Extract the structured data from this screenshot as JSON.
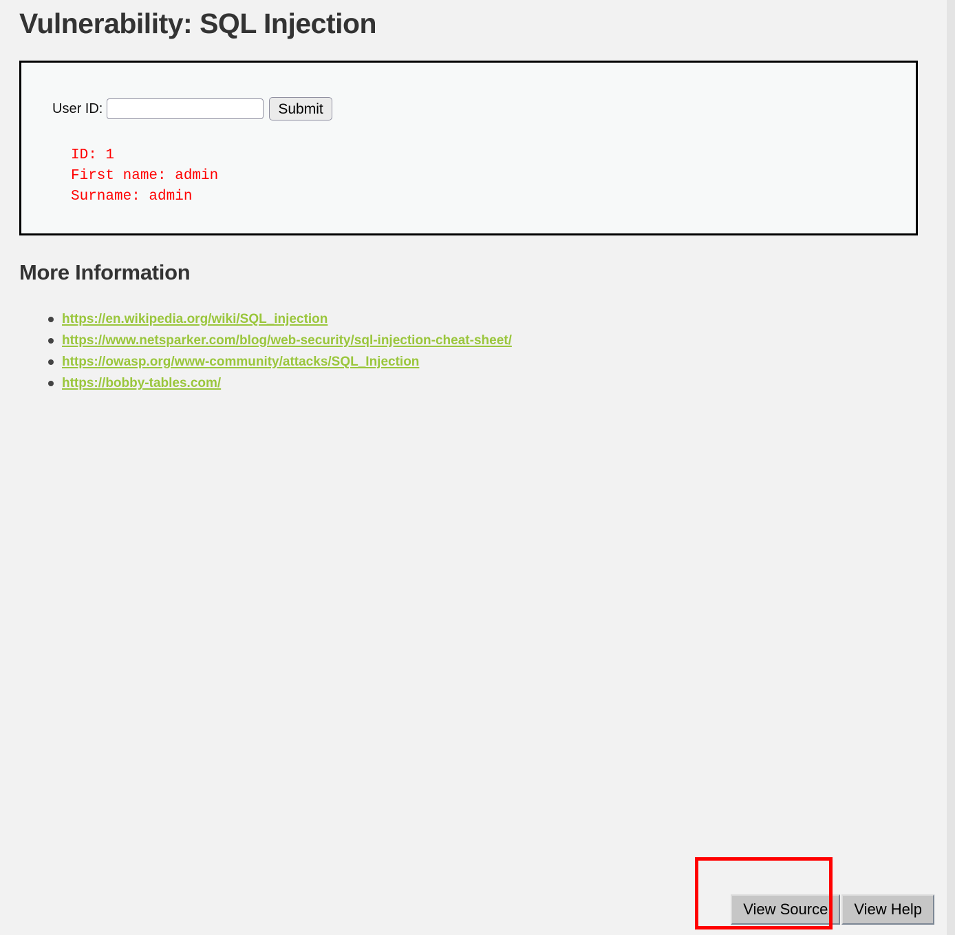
{
  "page": {
    "title": "Vulnerability: SQL Injection",
    "background_color": "#f2f2f2"
  },
  "vuln_form": {
    "label": "User ID:",
    "input_value": "",
    "input_placeholder": "",
    "submit_label": "Submit",
    "result_text": "ID: 1\nFirst name: admin\nSurname: admin",
    "result_color": "#ff0000",
    "panel_background": "#f7f9f9",
    "panel_border_color": "#000000"
  },
  "more_information": {
    "heading": "More Information",
    "link_color": "#9ac63c",
    "links": [
      {
        "text": "https://en.wikipedia.org/wiki/SQL_injection"
      },
      {
        "text": "https://www.netsparker.com/blog/web-security/sql-injection-cheat-sheet/"
      },
      {
        "text": "https://owasp.org/www-community/attacks/SQL_Injection"
      },
      {
        "text": "https://bobby-tables.com/"
      }
    ]
  },
  "bottom_bar": {
    "view_source_label": "View Source",
    "view_help_label": "View Help",
    "button_background": "#c6c6c6"
  },
  "annotation": {
    "color": "#ff0000",
    "target": "view-source-button"
  }
}
